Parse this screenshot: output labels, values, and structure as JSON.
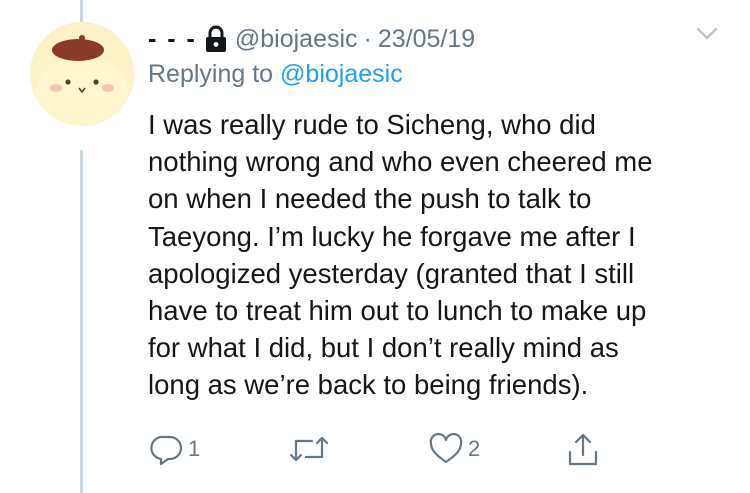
{
  "tweet": {
    "display_name": "- - -",
    "handle": "@biojaesic",
    "separator": "·",
    "date": "23/05/19",
    "replying_prefix": "Replying to",
    "replying_handle": "@biojaesic",
    "text_lines": [
      "I was really rude to Sicheng, who did",
      "nothing wrong and who even cheered me",
      "on when I needed the push to talk to",
      "Taeyong. I’m lucky he forgave me after I",
      "apologized yesterday (granted that I still",
      "have to treat him out to lunch to make up",
      "for what I did, but I don’t really mind as",
      "long as we’re back to being friends)."
    ]
  },
  "actions": {
    "reply_count": "1",
    "retweet_count": "",
    "like_count": "2"
  },
  "icons": {
    "lock": "lock-icon",
    "chevron": "chevron-down-icon",
    "reply": "reply-icon",
    "retweet": "retweet-icon",
    "like": "heart-icon",
    "share": "share-icon"
  },
  "colors": {
    "text": "#14171a",
    "muted": "#657786",
    "link": "#1da1f2",
    "avatar_bg": "#fbf3c7",
    "beret": "#8a3a2a"
  }
}
